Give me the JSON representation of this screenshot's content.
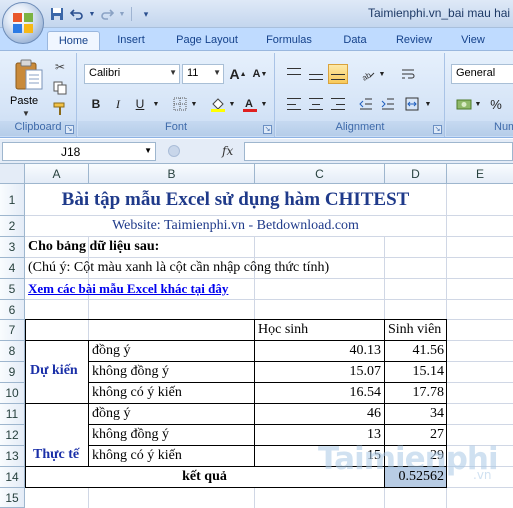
{
  "window": {
    "title": "Taimienphi.vn_bai mau hai"
  },
  "qat": {
    "icons": [
      "excel-icon",
      "save-icon",
      "undo-icon",
      "redo-icon",
      "customize-icon"
    ]
  },
  "tabs": [
    {
      "label": "Home",
      "active": true
    },
    {
      "label": "Insert"
    },
    {
      "label": "Page Layout"
    },
    {
      "label": "Formulas"
    },
    {
      "label": "Data"
    },
    {
      "label": "Review"
    },
    {
      "label": "View"
    }
  ],
  "ribbon": {
    "clipboard": {
      "label": "Clipboard",
      "paste_label": "Paste"
    },
    "font": {
      "label": "Font",
      "family": "Calibri",
      "size": "11",
      "grow": "A",
      "shrink": "A",
      "bold": "B",
      "italic": "I",
      "underline": "U"
    },
    "alignment": {
      "label": "Alignment"
    },
    "number": {
      "label": "Numb",
      "format": "General"
    }
  },
  "formula_bar": {
    "name_box": "J18",
    "fx": "fx",
    "content": ""
  },
  "columns": [
    "A",
    "B",
    "C",
    "D",
    "E"
  ],
  "rows": [
    "1",
    "2",
    "3",
    "4",
    "5",
    "6",
    "7",
    "8",
    "9",
    "10",
    "11",
    "12",
    "13",
    "14",
    "15"
  ],
  "sheet": {
    "title": "Bài tập mẫu Excel sử dụng hàm CHITEST",
    "website": "Website: Taimienphi.vn - Betdownload.com",
    "intro": "Cho bảng dữ liệu sau:",
    "note": "(Chú ý: Cột màu xanh là cột cần nhập công thức tính)",
    "link": "Xem các bài mẫu Excel khác tại đây",
    "headers": {
      "c": "Học sinh",
      "d": "Sinh viên"
    },
    "group1": "Dự kiến",
    "group2": "Thực tế",
    "rows": [
      {
        "label": "đồng ý",
        "c": "40.13",
        "d": "41.56"
      },
      {
        "label": "không đồng ý",
        "c": "15.07",
        "d": "15.14"
      },
      {
        "label": "không có ý kiến",
        "c": "16.54",
        "d": "17.78"
      },
      {
        "label": "đồng ý",
        "c": "46",
        "d": "34"
      },
      {
        "label": "không đồng ý",
        "c": "13",
        "d": "27"
      },
      {
        "label": "không có ý kiến",
        "c": "15",
        "d": "29"
      }
    ],
    "result_label": "kết quả",
    "result_value": "0.52562",
    "result_fill": "#b8cce4"
  },
  "watermark": {
    "text": "Taimienphi",
    "suffix": ".vn"
  }
}
